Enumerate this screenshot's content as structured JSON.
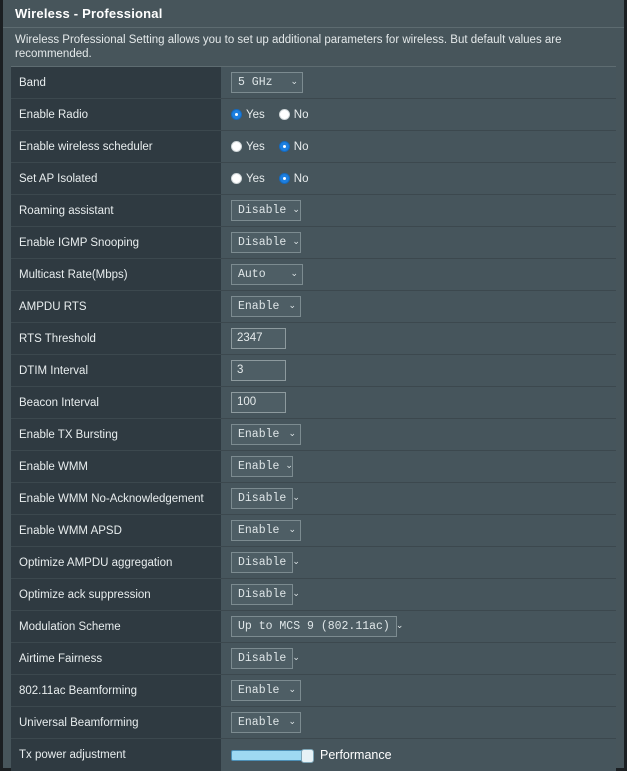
{
  "header": {
    "title": "Wireless - Professional"
  },
  "description": {
    "text": "Wireless Professional Setting allows you to set up additional parameters for wireless. But default values are recommended."
  },
  "icons": {
    "chevron_down": "⌄"
  },
  "radio_labels": {
    "yes": "Yes",
    "no": "No"
  },
  "colors": {
    "panel_bg": "#47555b",
    "label_cell_bg": "#2f3a41",
    "value_cell_bg": "#46555c",
    "radio_selected": "#1d7fe0",
    "slider_track": "#9ed9f2",
    "slider_border": "#4d8fb5",
    "text": "#e8edee"
  },
  "rows": [
    {
      "label": "Band",
      "control": "select",
      "value": "5 GHz"
    },
    {
      "label": "Enable Radio",
      "control": "radio",
      "selected": "Yes"
    },
    {
      "label": "Enable wireless scheduler",
      "control": "radio",
      "selected": "No"
    },
    {
      "label": "Set AP Isolated",
      "control": "radio",
      "selected": "No"
    },
    {
      "label": "Roaming assistant",
      "control": "select",
      "value": "Disable"
    },
    {
      "label": "Enable IGMP Snooping",
      "control": "select",
      "value": "Disable"
    },
    {
      "label": "Multicast Rate(Mbps)",
      "control": "select",
      "value": "Auto"
    },
    {
      "label": "AMPDU RTS",
      "control": "select",
      "value": "Enable"
    },
    {
      "label": "RTS Threshold",
      "control": "text",
      "value": "2347"
    },
    {
      "label": "DTIM Interval",
      "control": "text",
      "value": "3"
    },
    {
      "label": "Beacon Interval",
      "control": "text",
      "value": "100"
    },
    {
      "label": "Enable TX Bursting",
      "control": "select",
      "value": "Enable"
    },
    {
      "label": "Enable WMM",
      "control": "select",
      "value": "Enable"
    },
    {
      "label": "Enable WMM No-Acknowledgement",
      "control": "select",
      "value": "Disable"
    },
    {
      "label": "Enable WMM APSD",
      "control": "select",
      "value": "Enable"
    },
    {
      "label": "Optimize AMPDU aggregation",
      "control": "select",
      "value": "Disable"
    },
    {
      "label": "Optimize ack suppression",
      "control": "select",
      "value": "Disable"
    },
    {
      "label": "Modulation Scheme",
      "control": "select",
      "value": "Up to MCS 9 (802.11ac)"
    },
    {
      "label": "Airtime Fairness",
      "control": "select",
      "value": "Disable"
    },
    {
      "label": "802.11ac Beamforming",
      "control": "select",
      "value": "Enable"
    },
    {
      "label": "Universal Beamforming",
      "control": "select",
      "value": "Enable"
    },
    {
      "label": "Tx power adjustment",
      "control": "slider",
      "value": "Performance",
      "percent": 100
    }
  ]
}
